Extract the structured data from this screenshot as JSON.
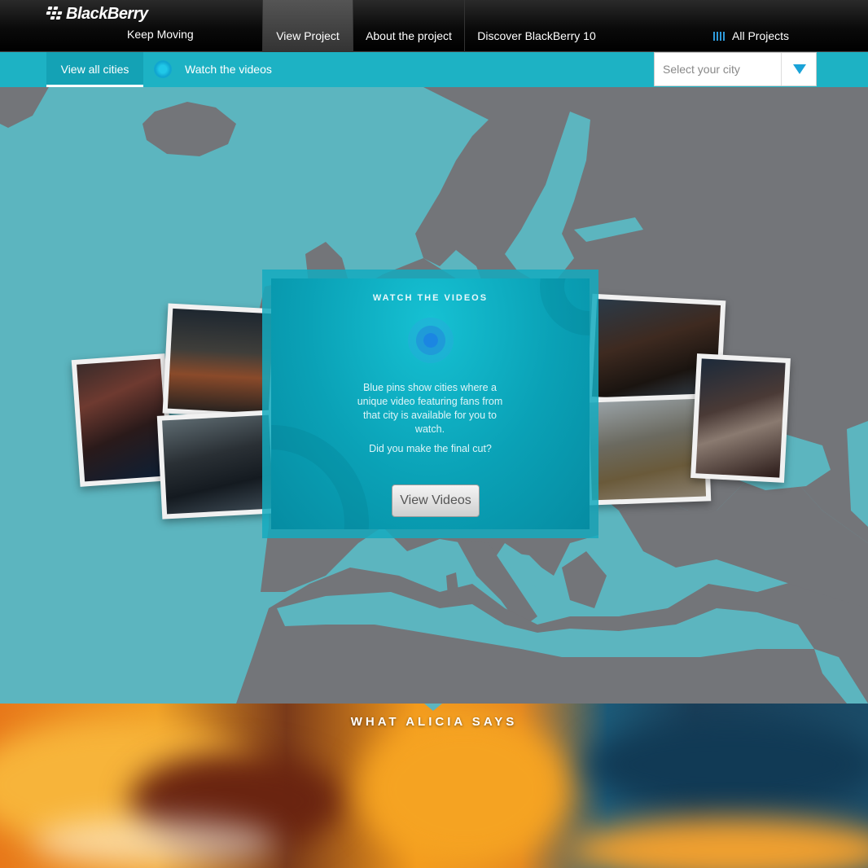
{
  "brand": {
    "name": "BlackBerry",
    "tagline": "Keep Moving"
  },
  "nav": {
    "items": [
      {
        "label": "View Project",
        "active": true
      },
      {
        "label": "About the project",
        "active": false
      },
      {
        "label": "Discover BlackBerry 10",
        "active": false
      }
    ],
    "all_projects": "All Projects"
  },
  "subnav": {
    "tabs": [
      {
        "label": "View all cities",
        "active": true
      },
      {
        "label": "Watch the videos",
        "active": false
      }
    ],
    "city_select": {
      "placeholder": "Select your city"
    }
  },
  "card": {
    "title": "WATCH THE VIDEOS",
    "description": "Blue pins show cities where a unique video featuring fans from that city is available for you to watch.",
    "question": "Did you make the final cut?",
    "button": "View Videos"
  },
  "banner": {
    "title": "WHAT ALICIA SAYS"
  },
  "colors": {
    "accent": "#1db2c4",
    "map_sea": "#5cb5bf",
    "map_land": "#727579",
    "pin_blue": "#1b86e2"
  },
  "icons": [
    "blackberry-logo-icon",
    "all-projects-icon",
    "blue-pin-icon",
    "dropdown-arrow-icon"
  ]
}
